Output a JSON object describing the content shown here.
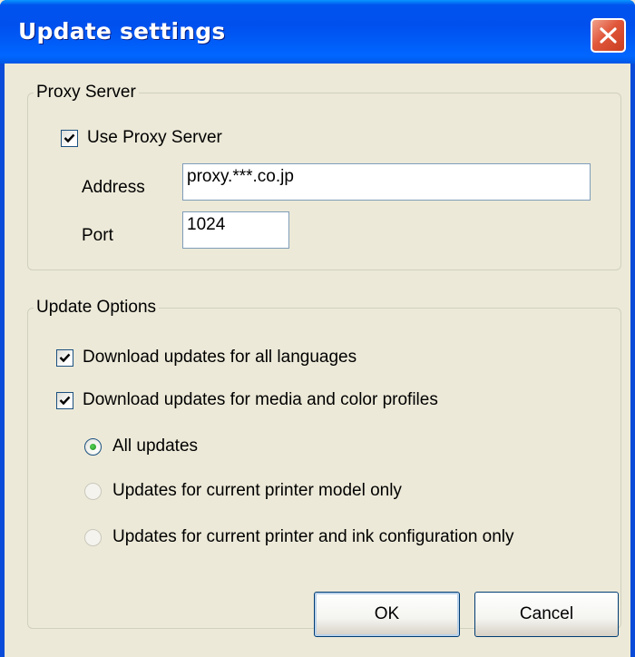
{
  "window": {
    "title": "Update settings"
  },
  "proxy_group": {
    "label": "Proxy Server",
    "use_proxy": {
      "label": "Use Proxy Server",
      "checked": true
    },
    "address": {
      "label": "Address",
      "value": "proxy.***.co.jp"
    },
    "port": {
      "label": "Port",
      "value": "1024"
    }
  },
  "options_group": {
    "label": "Update Options",
    "all_languages": {
      "label": "Download updates for all languages",
      "checked": true
    },
    "media_profiles": {
      "label": "Download updates for media and color profiles",
      "checked": true
    },
    "radios": [
      {
        "label": "All updates",
        "selected": true
      },
      {
        "label": "Updates for current printer model only",
        "selected": false
      },
      {
        "label": "Updates for current printer and ink configuration only",
        "selected": false
      }
    ]
  },
  "buttons": {
    "ok": "OK",
    "cancel": "Cancel"
  },
  "colors": {
    "titlebar": "#0054E3",
    "dialog_bg": "#ECE9D8",
    "close_button": "#E0563A",
    "radio_dot": "#21A121"
  },
  "icons": {
    "close": "close-icon",
    "check": "checkmark-icon"
  }
}
